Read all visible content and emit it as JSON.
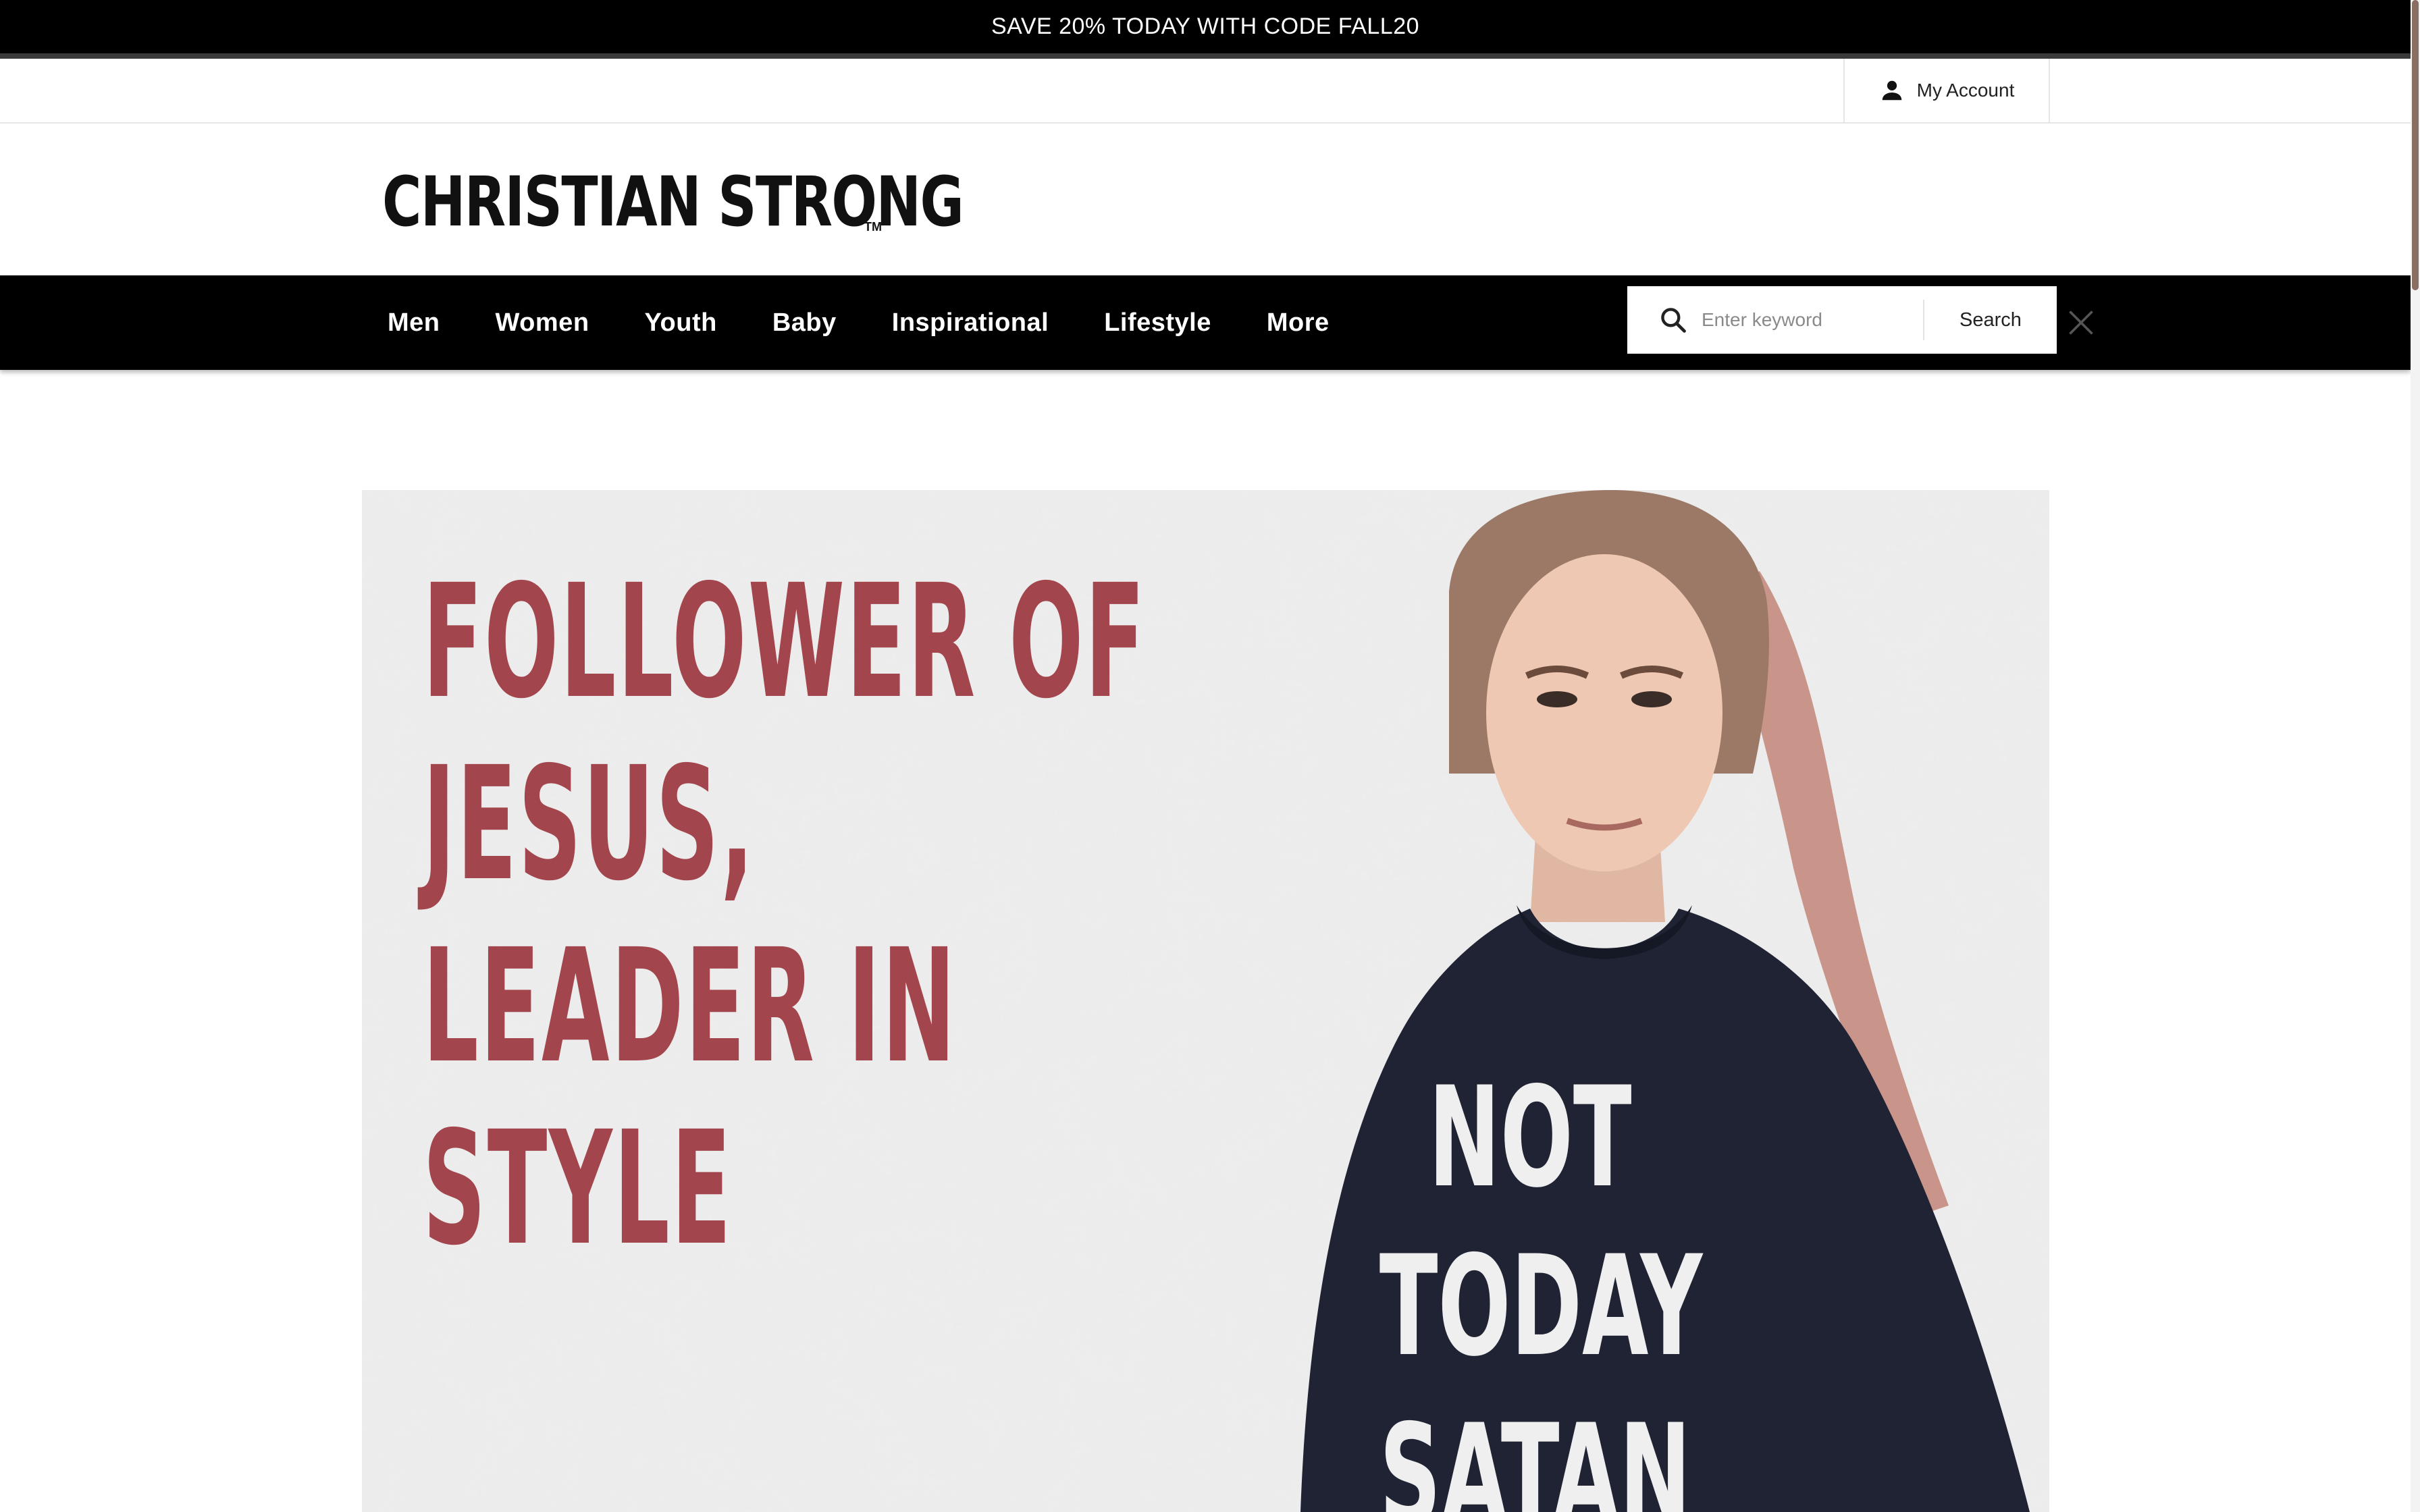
{
  "promo": {
    "text": "SAVE 20% TODAY WITH CODE FALL20"
  },
  "utility": {
    "account_label": "My Account",
    "account_icon": "user-icon"
  },
  "brand": {
    "logo_text": "CHRISTIAN STRONG",
    "trademark": "TM"
  },
  "nav": {
    "items": [
      {
        "label": "Men"
      },
      {
        "label": "Women"
      },
      {
        "label": "Youth"
      },
      {
        "label": "Baby"
      },
      {
        "label": "Inspirational"
      },
      {
        "label": "Lifestyle"
      },
      {
        "label": "More"
      }
    ]
  },
  "search": {
    "placeholder": "Enter keyword",
    "button_label": "Search",
    "icon": "search-icon",
    "close_icon": "close-icon"
  },
  "hero": {
    "headline_lines": [
      "FOLLOWER OF",
      "JESUS,",
      "LEADER IN",
      "STYLE"
    ],
    "shirt_lines": [
      "NOT",
      "TODAY",
      "SATAN"
    ]
  },
  "colors": {
    "promo_bg": "#000000",
    "nav_bg": "#000000",
    "headline": "#a3454d",
    "shirt": "#1f2333"
  }
}
